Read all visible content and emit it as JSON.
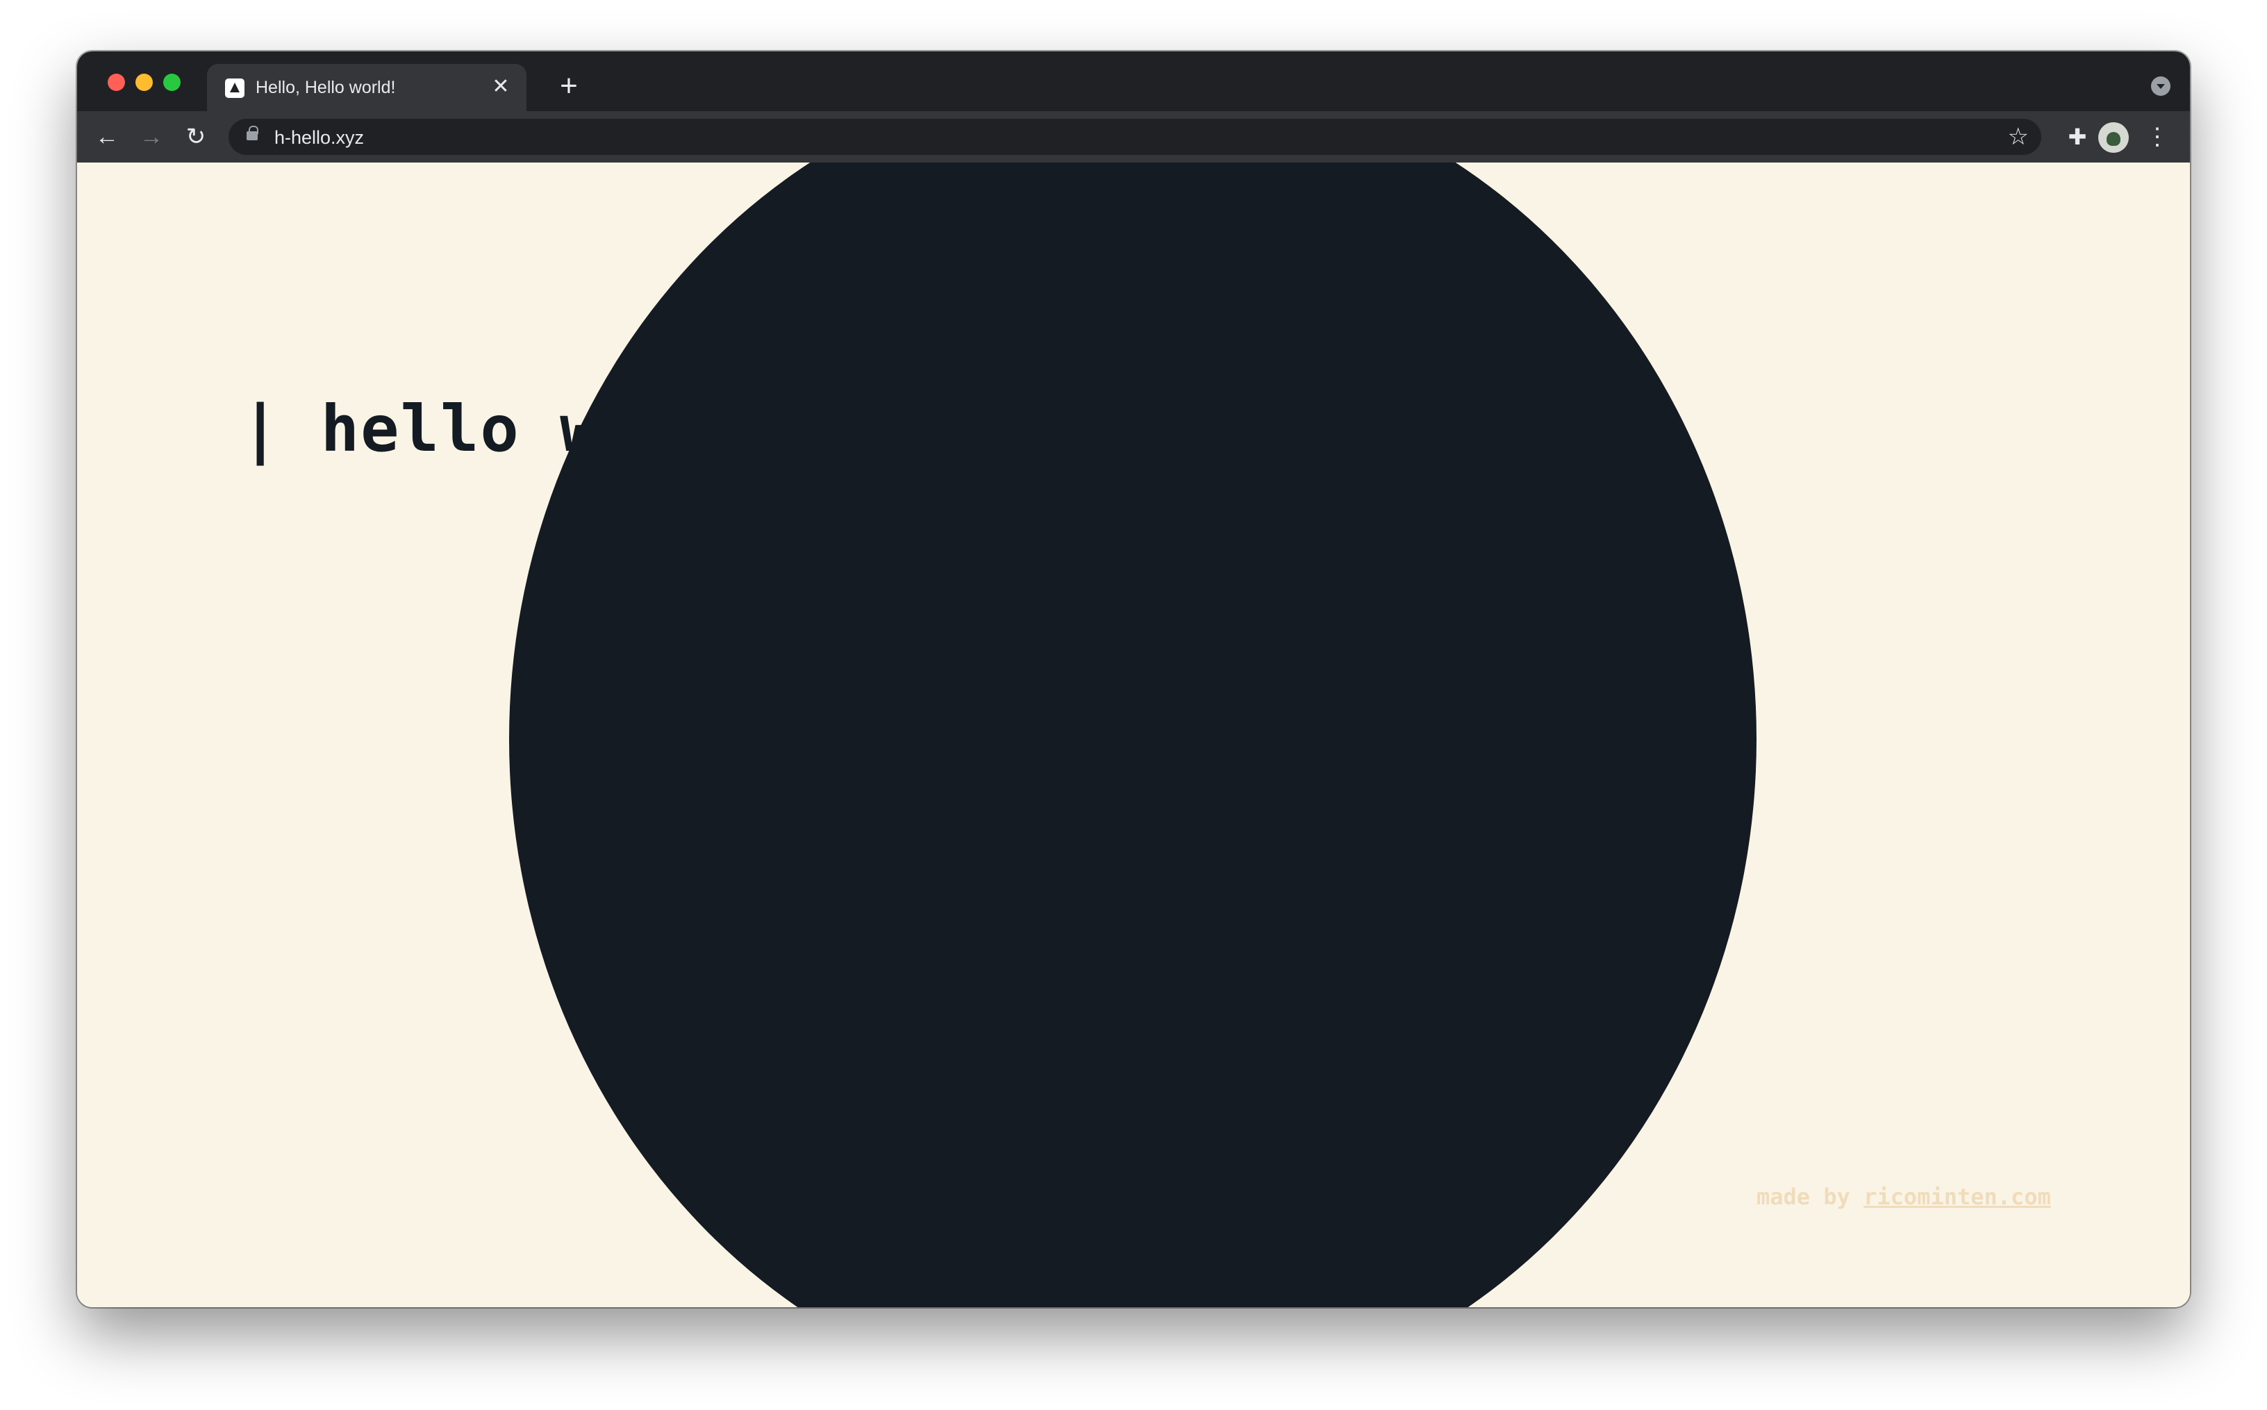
{
  "browser": {
    "tab": {
      "title": "Hello, Hello world!",
      "close_glyph": "✕"
    },
    "new_tab_glyph": "+",
    "nav": {
      "back_glyph": "←",
      "forward_glyph": "→",
      "reload_glyph": "↻"
    },
    "address": {
      "url": "h-hello.xyz"
    },
    "bookmark_glyph": "☆",
    "extensions_glyph": "✚",
    "menu_glyph": "⋮",
    "icons": [
      "favicon-icon",
      "lock-icon",
      "star-icon",
      "extensions-icon",
      "profile-avatar",
      "menu-icon"
    ]
  },
  "page": {
    "heading": "| hello world",
    "credit": {
      "prefix": "made by ",
      "link_text": "ricominten.com"
    }
  },
  "colors": {
    "background": "#faf4e7",
    "ink": "#151b22",
    "credit": "#f0dcbb",
    "chrome_dark": "#202124",
    "chrome_toolbar": "#35363a"
  }
}
